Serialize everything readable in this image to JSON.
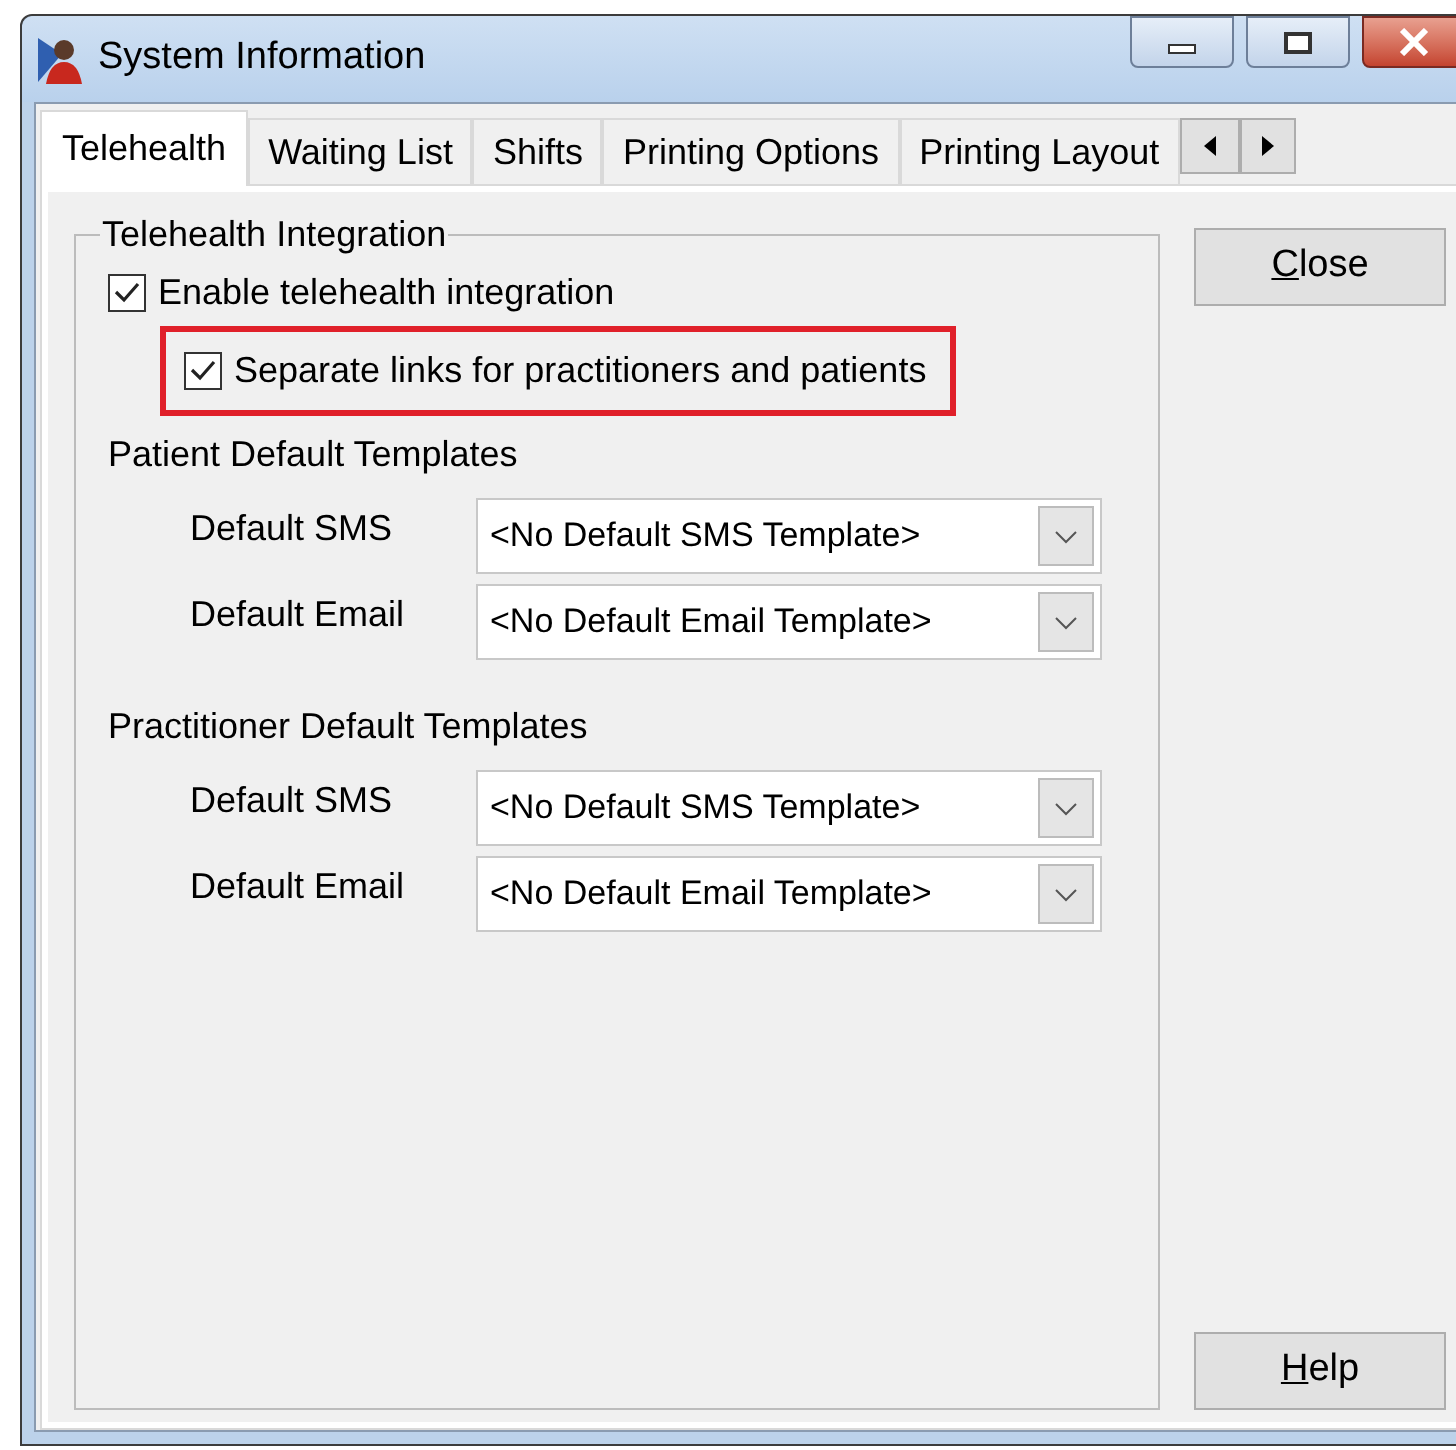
{
  "window": {
    "title": "System Information"
  },
  "tabs": [
    {
      "label": "Telehealth",
      "selected": true
    },
    {
      "label": "Waiting List",
      "selected": false
    },
    {
      "label": "Shifts",
      "selected": false
    },
    {
      "label": "Printing Options",
      "selected": false
    },
    {
      "label": "Printing Layout",
      "selected": false
    }
  ],
  "group": {
    "title": "Telehealth Integration",
    "checkboxes": [
      {
        "label": "Enable telehealth integration",
        "checked": true,
        "highlighted": false,
        "indented": false
      },
      {
        "label": "Separate links for practitioners and patients",
        "checked": true,
        "highlighted": true,
        "indented": true
      }
    ],
    "sections": [
      {
        "title": "Patient Default Templates",
        "fields": [
          {
            "label": "Default SMS",
            "value": "<No Default SMS Template>"
          },
          {
            "label": "Default Email",
            "value": "<No Default Email Template>"
          }
        ]
      },
      {
        "title": "Practitioner Default Templates",
        "fields": [
          {
            "label": "Default SMS",
            "value": "<No Default SMS Template>"
          },
          {
            "label": "Default Email",
            "value": "<No Default Email Template>"
          }
        ]
      }
    ]
  },
  "buttons": [
    {
      "label": "Close",
      "mnemonic": true
    },
    {
      "label": "Help",
      "mnemonic": true
    }
  ]
}
